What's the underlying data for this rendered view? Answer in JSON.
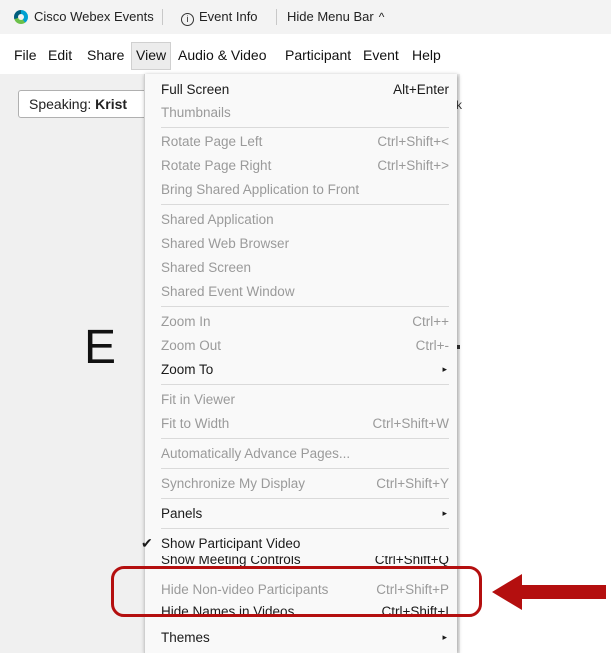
{
  "titlebar": {
    "app_title": "Cisco Webex Events",
    "event_info": "Event Info",
    "hide_menu_bar": "Hide Menu Bar",
    "caret": "^"
  },
  "menubar": {
    "file": "File",
    "edit": "Edit",
    "share": "Share",
    "view": "View",
    "audio_video": "Audio & Video",
    "participant": "Participant",
    "event": "Event",
    "help": "Help"
  },
  "content": {
    "speaking_prefix": "Speaking: ",
    "speaking_name": "Krist",
    "slide_letter": "E",
    "stray_char": "k"
  },
  "view_menu": {
    "full_screen": {
      "label": "Full Screen",
      "shortcut": "Alt+Enter"
    },
    "thumbnails": {
      "label": "Thumbnails"
    },
    "rotate_left": {
      "label": "Rotate Page Left",
      "shortcut": "Ctrl+Shift+<"
    },
    "rotate_right": {
      "label": "Rotate Page Right",
      "shortcut": "Ctrl+Shift+>"
    },
    "bring_front": {
      "label": "Bring Shared Application to Front"
    },
    "shared_app": {
      "label": "Shared Application"
    },
    "shared_web": {
      "label": "Shared Web Browser"
    },
    "shared_screen": {
      "label": "Shared Screen"
    },
    "shared_event": {
      "label": "Shared Event Window"
    },
    "zoom_in": {
      "label": "Zoom In",
      "shortcut": "Ctrl++"
    },
    "zoom_out": {
      "label": "Zoom Out",
      "shortcut": "Ctrl+-"
    },
    "zoom_to": {
      "label": "Zoom To"
    },
    "fit_viewer": {
      "label": "Fit in Viewer"
    },
    "fit_width": {
      "label": "Fit to Width",
      "shortcut": "Ctrl+Shift+W"
    },
    "auto_advance": {
      "label": "Automatically Advance Pages..."
    },
    "sync_display": {
      "label": "Synchronize My Display",
      "shortcut": "Ctrl+Shift+Y"
    },
    "panels": {
      "label": "Panels"
    },
    "show_video": {
      "label": "Show Participant Video",
      "checked": true
    },
    "show_controls": {
      "label": "Show Meeting Controls",
      "shortcut": "Ctrl+Shift+Q",
      "checked": true
    },
    "hide_nonvideo": {
      "label": "Hide Non-video Participants",
      "shortcut": "Ctrl+Shift+P"
    },
    "hide_names": {
      "label": "Hide Names in Videos",
      "shortcut": "Ctrl+Shift+I"
    },
    "themes": {
      "label": "Themes"
    }
  },
  "glyphs": {
    "check": "✔",
    "submenu": "▸"
  },
  "colors": {
    "highlight": "#b40f0f",
    "disabled_text": "#9a9a9a"
  }
}
